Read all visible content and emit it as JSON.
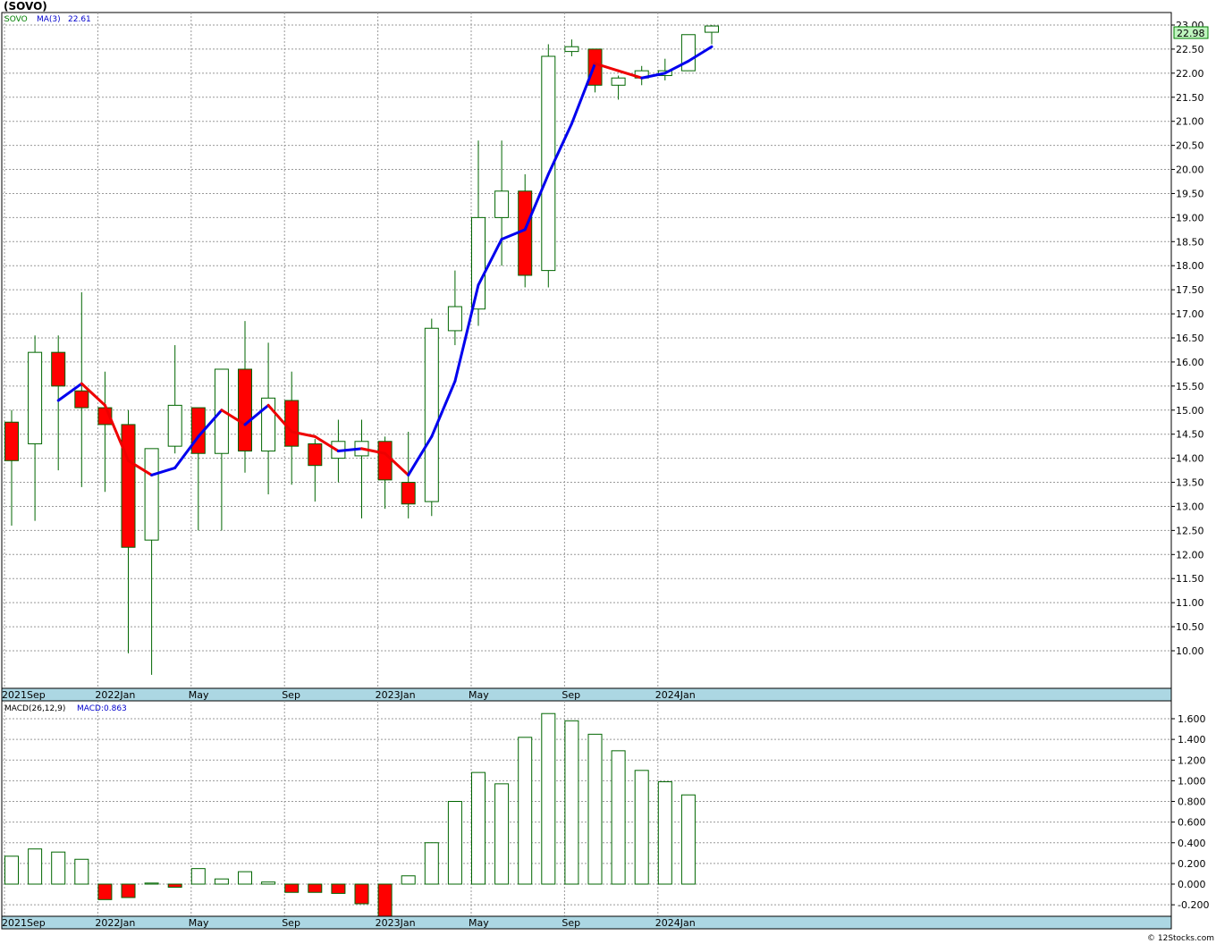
{
  "chart_data": [
    {
      "type": "candlestick",
      "title": "(SOVO)",
      "symbol_label": "SOVO",
      "ma_label": "MA(3)",
      "ma_value": "22.61",
      "last_price": "22.98",
      "ylim": [
        9.5,
        23.2
      ],
      "y_ticks": [
        "23.00",
        "22.50",
        "22.00",
        "21.50",
        "21.00",
        "20.50",
        "20.00",
        "19.50",
        "19.00",
        "18.50",
        "18.00",
        "17.50",
        "17.00",
        "16.50",
        "16.00",
        "15.50",
        "15.00",
        "14.50",
        "14.00",
        "13.50",
        "13.00",
        "12.50",
        "12.00",
        "11.50",
        "11.00",
        "10.50",
        "10.00"
      ],
      "x_labels": [
        {
          "index": 0,
          "text": "2021Sep"
        },
        {
          "index": 4,
          "text": "2022Jan"
        },
        {
          "index": 8,
          "text": "May"
        },
        {
          "index": 12,
          "text": "Sep"
        },
        {
          "index": 16,
          "text": "2023Jan"
        },
        {
          "index": 20,
          "text": "May"
        },
        {
          "index": 24,
          "text": "Sep"
        },
        {
          "index": 28,
          "text": "2024Jan"
        }
      ],
      "candles": [
        {
          "date": "2021-09",
          "open": 14.75,
          "high": 15.0,
          "low": 12.6,
          "close": 13.95
        },
        {
          "date": "2021-10",
          "open": 14.3,
          "high": 16.55,
          "low": 12.7,
          "close": 16.2
        },
        {
          "date": "2021-11",
          "open": 16.2,
          "high": 16.55,
          "low": 13.75,
          "close": 15.5
        },
        {
          "date": "2021-12",
          "open": 15.4,
          "high": 17.45,
          "low": 13.4,
          "close": 15.05
        },
        {
          "date": "2022-01",
          "open": 15.05,
          "high": 15.8,
          "low": 13.3,
          "close": 14.7
        },
        {
          "date": "2022-02",
          "open": 14.7,
          "high": 15.0,
          "low": 9.95,
          "close": 12.15
        },
        {
          "date": "2022-03",
          "open": 12.3,
          "high": 14.2,
          "low": 9.5,
          "close": 14.2
        },
        {
          "date": "2022-04",
          "open": 14.25,
          "high": 16.35,
          "low": 14.1,
          "close": 15.1
        },
        {
          "date": "2022-05",
          "open": 15.05,
          "high": 15.05,
          "low": 12.5,
          "close": 14.1
        },
        {
          "date": "2022-06",
          "open": 14.1,
          "high": 15.85,
          "low": 12.5,
          "close": 15.85
        },
        {
          "date": "2022-07",
          "open": 15.85,
          "high": 16.85,
          "low": 13.7,
          "close": 14.15
        },
        {
          "date": "2022-08",
          "open": 14.15,
          "high": 16.4,
          "low": 13.25,
          "close": 15.25
        },
        {
          "date": "2022-09",
          "open": 15.2,
          "high": 15.8,
          "low": 13.45,
          "close": 14.25
        },
        {
          "date": "2022-10",
          "open": 14.3,
          "high": 14.4,
          "low": 13.1,
          "close": 13.85
        },
        {
          "date": "2022-11",
          "open": 14.0,
          "high": 14.8,
          "low": 13.5,
          "close": 14.35
        },
        {
          "date": "2022-12",
          "open": 14.05,
          "high": 14.8,
          "low": 12.75,
          "close": 14.35
        },
        {
          "date": "2023-01",
          "open": 14.35,
          "high": 14.45,
          "low": 12.95,
          "close": 13.55
        },
        {
          "date": "2023-02",
          "open": 13.5,
          "high": 14.55,
          "low": 12.75,
          "close": 13.05
        },
        {
          "date": "2023-03",
          "open": 13.1,
          "high": 16.9,
          "low": 12.8,
          "close": 16.7
        },
        {
          "date": "2023-04",
          "open": 16.65,
          "high": 17.9,
          "low": 16.35,
          "close": 17.15
        },
        {
          "date": "2023-05",
          "open": 17.1,
          "high": 20.6,
          "low": 16.75,
          "close": 19.0
        },
        {
          "date": "2023-06",
          "open": 19.0,
          "high": 20.6,
          "low": 18.0,
          "close": 19.55
        },
        {
          "date": "2023-07",
          "open": 19.55,
          "high": 19.9,
          "low": 17.55,
          "close": 17.8
        },
        {
          "date": "2023-08",
          "open": 17.9,
          "high": 22.6,
          "low": 17.55,
          "close": 22.35
        },
        {
          "date": "2023-09",
          "open": 22.45,
          "high": 22.7,
          "low": 22.35,
          "close": 22.55
        },
        {
          "date": "2023-10",
          "open": 22.5,
          "high": 22.5,
          "low": 21.6,
          "close": 21.75
        },
        {
          "date": "2023-11",
          "open": 21.75,
          "high": 21.95,
          "low": 21.45,
          "close": 21.9
        },
        {
          "date": "2023-12",
          "open": 21.9,
          "high": 22.15,
          "low": 21.75,
          "close": 22.05
        },
        {
          "date": "2024-01",
          "open": 21.95,
          "high": 22.3,
          "low": 21.85,
          "close": 22.05
        },
        {
          "date": "2024-02",
          "open": 22.05,
          "high": 22.8,
          "low": 22.05,
          "close": 22.8
        },
        {
          "date": "2024-03",
          "open": 22.85,
          "high": 23.0,
          "low": 22.6,
          "close": 22.98
        }
      ],
      "ma": [
        null,
        null,
        15.2,
        15.55,
        15.1,
        13.95,
        13.65,
        13.8,
        14.45,
        15.0,
        14.7,
        15.1,
        14.55,
        14.45,
        14.15,
        14.2,
        14.1,
        13.65,
        14.45,
        15.6,
        17.6,
        18.55,
        18.75,
        19.9,
        20.95,
        22.2,
        22.05,
        21.9,
        22.0,
        22.25,
        22.55
      ],
      "ma_colors": {
        "up": "#0000ee",
        "down": "#ee0000"
      },
      "colors": {
        "up_fill": "#ffffff",
        "down_fill": "#ff0000",
        "outline": "#006600"
      }
    },
    {
      "type": "bar",
      "title": "MACD(26,12,9)",
      "value_label": "MACD:0.863",
      "ylim": [
        -0.32,
        1.72
      ],
      "y_ticks": [
        "1.600",
        "1.400",
        "1.200",
        "1.000",
        "0.800",
        "0.600",
        "0.400",
        "0.200",
        "0.000",
        "-0.200"
      ],
      "values": [
        0.27,
        0.34,
        0.31,
        0.24,
        -0.15,
        -0.13,
        0.01,
        -0.03,
        0.15,
        0.05,
        0.12,
        0.02,
        -0.08,
        -0.08,
        -0.09,
        -0.19,
        -0.36,
        0.08,
        0.4,
        0.8,
        1.08,
        0.97,
        1.42,
        1.65,
        1.58,
        1.45,
        1.29,
        1.1,
        0.99,
        0.863
      ]
    }
  ],
  "footer": {
    "credit": "© 12Stocks.com"
  }
}
